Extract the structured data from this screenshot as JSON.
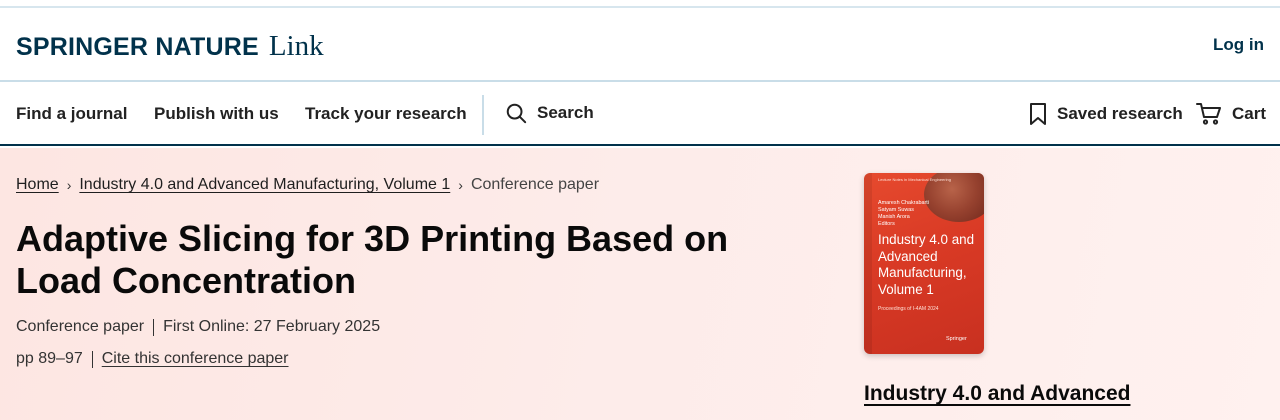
{
  "header": {
    "brand_primary": "SPRINGER NATURE",
    "brand_secondary": "Link",
    "login_label": "Log in"
  },
  "nav": {
    "items": [
      {
        "label": "Find a journal"
      },
      {
        "label": "Publish with us"
      },
      {
        "label": "Track your research"
      }
    ],
    "search_label": "Search",
    "saved_label": "Saved research",
    "cart_label": "Cart"
  },
  "breadcrumb": {
    "home": "Home",
    "book": "Industry 4.0 and Advanced Manufacturing, Volume 1",
    "current": "Conference paper",
    "separator": "›"
  },
  "article": {
    "title": "Adaptive Slicing for 3D Printing Based on Load Concentration",
    "type": "Conference paper",
    "first_online": "First Online: 27 February 2025",
    "pages": "pp 89–97",
    "cite_label": "Cite this conference paper"
  },
  "cover": {
    "series": "Lecture Notes in Mechanical Engineering",
    "editors": [
      "Amaresh Chakrabarti",
      "Satyam Suwas",
      "Manish Arora",
      "Editors"
    ],
    "title": "Industry 4.0 and Advanced Manufacturing, Volume 1",
    "subtitle": "Proceedings of I-4AM 2024",
    "publisher": "Springer"
  },
  "book": {
    "title_partial": "Industry 4.0 and Advanced"
  },
  "colors": {
    "brand": "#01324b",
    "hero_bg": "#fde6e2",
    "cover": "#e64a2e"
  }
}
